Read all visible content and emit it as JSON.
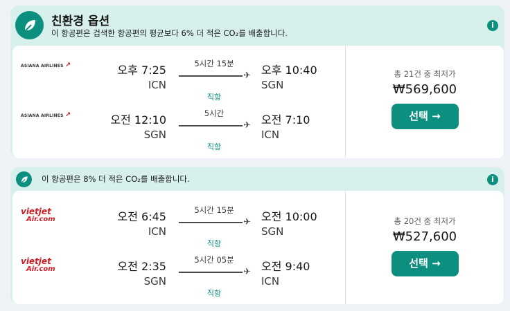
{
  "card1": {
    "title": "친환경 옵션",
    "message": "이 항공편은 검색한 항공편의 평균보다 6% 더 적은 CO₂를 배출합니다.",
    "info_icon": "i",
    "legs": [
      {
        "airline": "ASIANA AIRLINES",
        "dep_time": "오후 7:25",
        "dep_code": "ICN",
        "duration": "5시간 15분",
        "stops": "직항",
        "arr_time": "오후 10:40",
        "arr_code": "SGN"
      },
      {
        "airline": "ASIANA AIRLINES",
        "dep_time": "오전 12:10",
        "dep_code": "SGN",
        "duration": "5시간",
        "stops": "직항",
        "arr_time": "오전 7:10",
        "arr_code": "ICN"
      }
    ],
    "price_count": "총 21건 중 최저가",
    "price": "₩569,600",
    "select": "선택 →"
  },
  "card2": {
    "message": "이 항공편은 8% 더 적은 CO₂를 배출합니다.",
    "info_icon": "i",
    "legs": [
      {
        "airline_top": "vietjet",
        "airline_bot": "Air.com",
        "dep_time": "오전 6:45",
        "dep_code": "ICN",
        "duration": "5시간 15분",
        "stops": "직항",
        "arr_time": "오전 10:00",
        "arr_code": "SGN"
      },
      {
        "airline_top": "vietjet",
        "airline_bot": "Air.com",
        "dep_time": "오전 2:35",
        "dep_code": "SGN",
        "duration": "5시간 05분",
        "stops": "직항",
        "arr_time": "오전 9:40",
        "arr_code": "ICN"
      }
    ],
    "price_count": "총 20건 중 최저가",
    "price": "₩527,600",
    "select": "선택 →"
  },
  "icons": {
    "leaf": "leaf-icon",
    "plane": "✈",
    "info": "info-icon"
  },
  "colors": {
    "accent": "#0c8f7f",
    "eco_bg": "#d7f0ec",
    "page_bg": "#eff3f8"
  }
}
